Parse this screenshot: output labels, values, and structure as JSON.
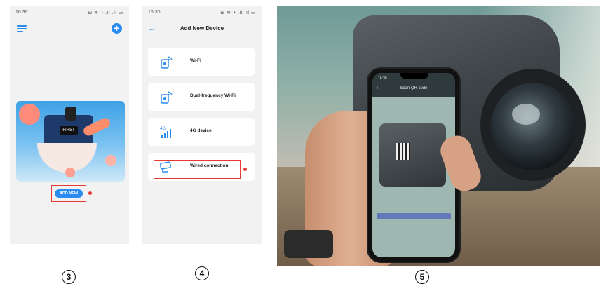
{
  "colors": {
    "accent_blue": "#2a8cf0",
    "highlight_red": "#e53935",
    "phone_bg": "#f2f2f2"
  },
  "step3": {
    "status_time": "16:30",
    "status_icons": "⊞ ≋ ◔ .ıl .ıl ▭",
    "menu_icon": "menu-icon",
    "add_icon": "plus-circle-icon",
    "hero_sign": "FIRST",
    "add_new_label": "ADD NEW",
    "step_number": "3"
  },
  "step4": {
    "status_time": "16:30",
    "status_icons": "⊞ ≋ ◔ .ıl .ıl ▭",
    "back_icon": "arrow-left-icon",
    "title": "Add New Device",
    "devices": [
      {
        "label": "Wi-Fi",
        "icon": "wifi-camera-icon"
      },
      {
        "label": "Dual-frequency Wi-Fi",
        "icon": "dual-wifi-camera-icon"
      },
      {
        "label": "4G device",
        "icon": "4g-signal-icon"
      },
      {
        "label": "Wired connection",
        "icon": "wired-camera-icon"
      }
    ],
    "step_number": "4"
  },
  "step5": {
    "phone_time": "16:30",
    "phone_title": "Scan QR code",
    "step_number": "5"
  }
}
